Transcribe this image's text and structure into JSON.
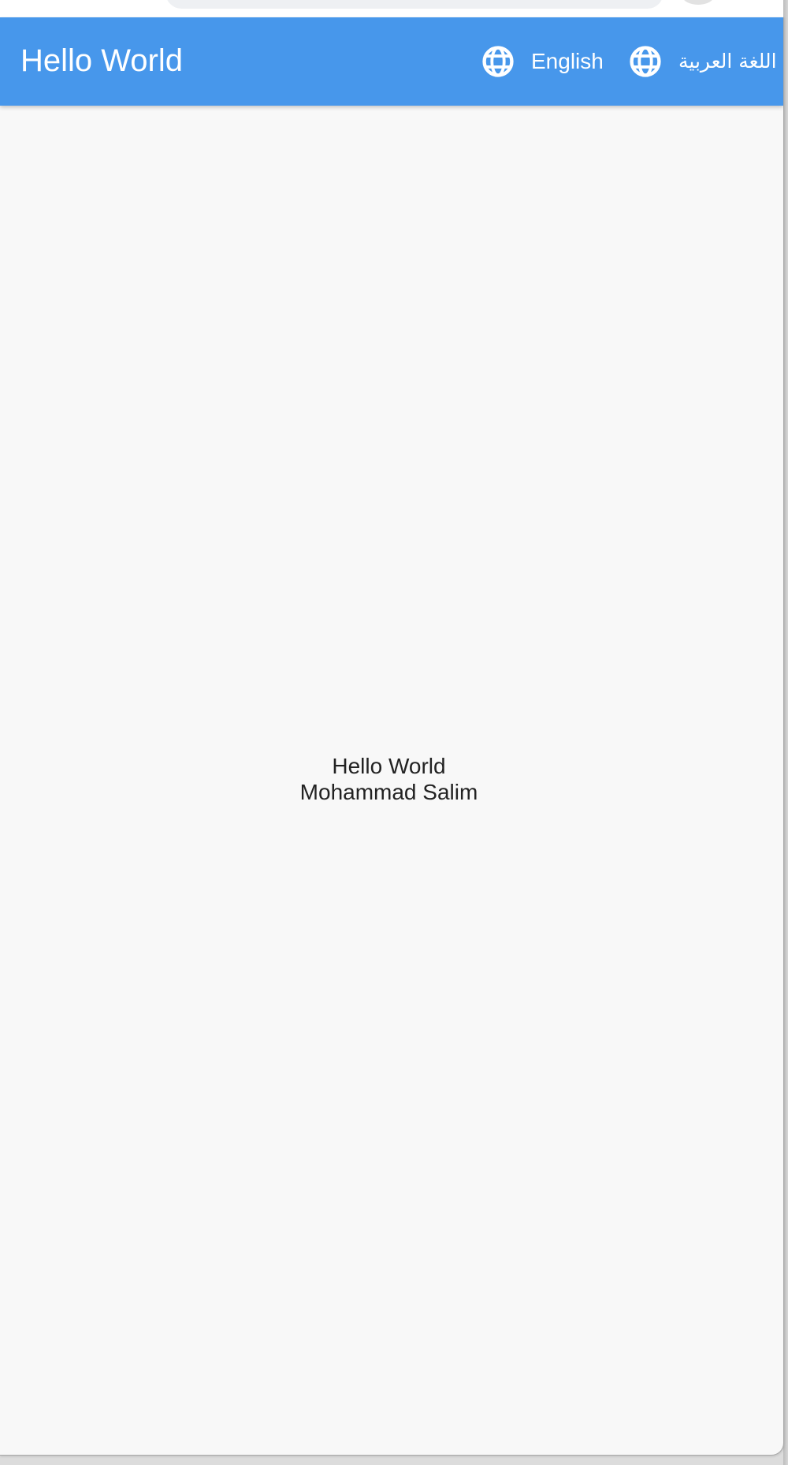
{
  "app_bar": {
    "title": "Hello World",
    "actions": [
      {
        "label": "English",
        "icon": "globe-icon"
      },
      {
        "label": "اللغة العربية",
        "icon": "globe-icon"
      }
    ],
    "background_color": "#4797eb"
  },
  "body": {
    "line_1": "Hello World",
    "line_2": "Mohammad Salim"
  }
}
